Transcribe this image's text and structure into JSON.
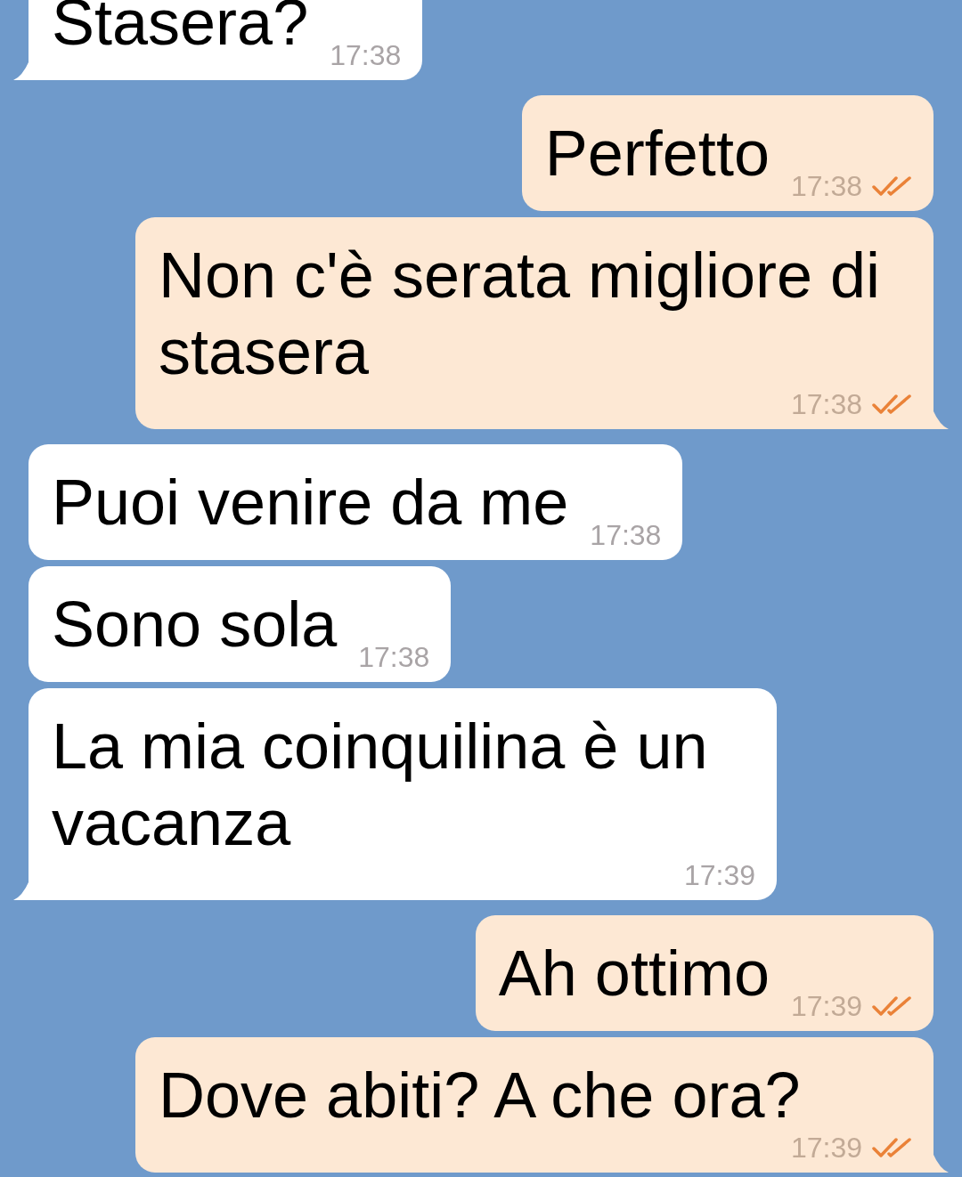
{
  "messages": [
    {
      "kind": "received",
      "text": "Stasera?",
      "time": "17:38",
      "tail": true
    },
    {
      "kind": "sent",
      "text": "Perfetto",
      "time": "17:38",
      "tail": false,
      "read": true
    },
    {
      "kind": "sent",
      "text": "Non c'è serata migliore di stasera",
      "time": "17:38",
      "tail": true,
      "read": true
    },
    {
      "kind": "received",
      "text": "Puoi venire da me",
      "time": "17:38",
      "tail": false
    },
    {
      "kind": "received",
      "text": "Sono sola",
      "time": "17:38",
      "tail": false
    },
    {
      "kind": "received",
      "text": "La mia coinquilina è un vacanza",
      "time": "17:39",
      "tail": true
    },
    {
      "kind": "sent",
      "text": "Ah ottimo",
      "time": "17:39",
      "tail": false,
      "read": true
    },
    {
      "kind": "sent",
      "text": "Dove abiti? A che ora?",
      "time": "17:39",
      "tail": true,
      "read": true
    }
  ]
}
